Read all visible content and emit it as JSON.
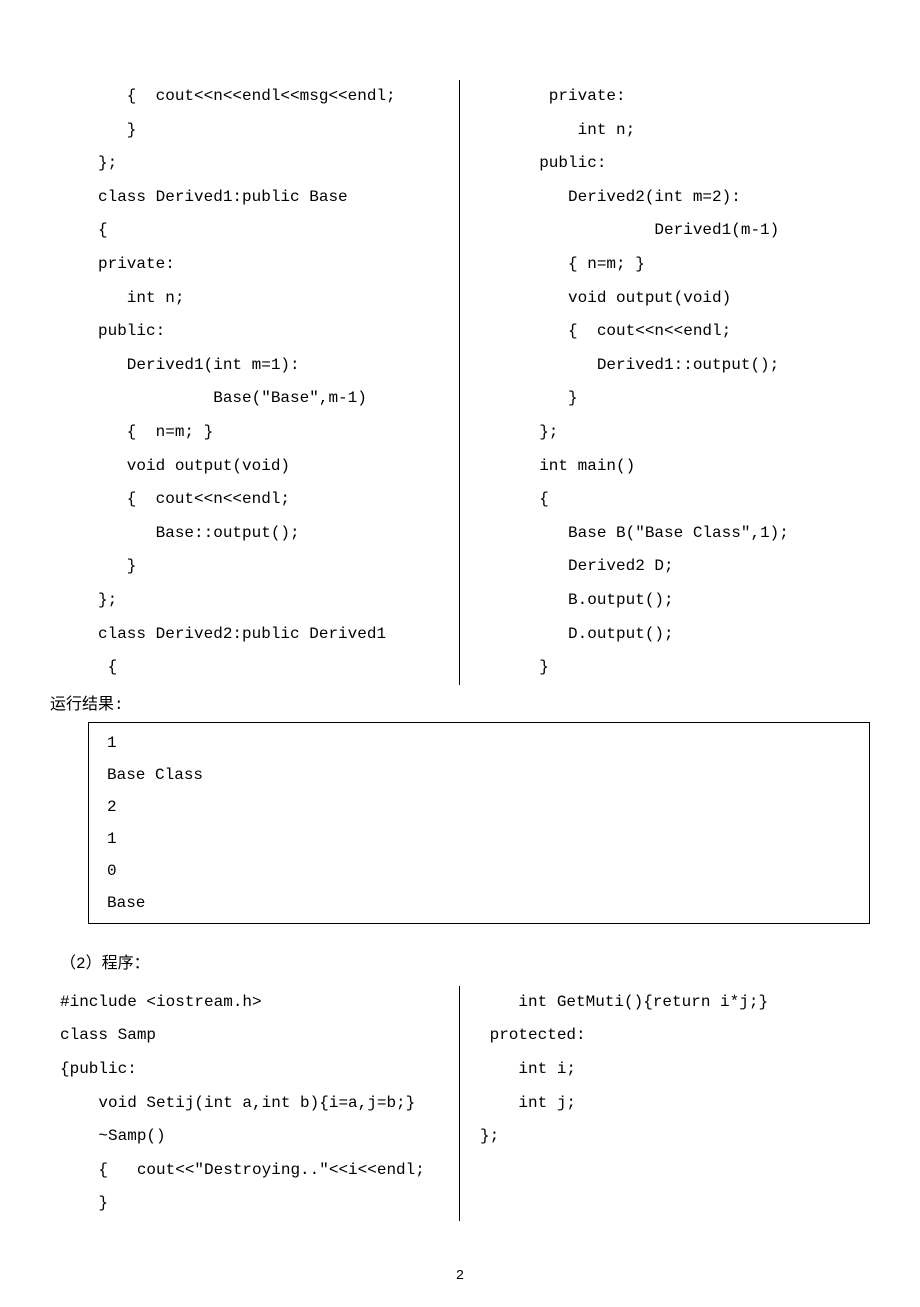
{
  "code_block_1": {
    "left": "   {  cout<<n<<endl<<msg<<endl;\n   }\n};\nclass Derived1:public Base\n{\nprivate:\n   int n;\npublic:\n   Derived1(int m=1):\n            Base(\"Base\",m-1)\n   {  n=m; }\n   void output(void)\n   {  cout<<n<<endl;\n      Base::output();\n   }\n};\nclass Derived2:public Derived1\n {",
    "right": "   private:\n      int n;\n  public:\n     Derived2(int m=2):\n              Derived1(m-1)\n     { n=m; }\n     void output(void)\n     {  cout<<n<<endl;\n        Derived1::output();\n     }\n  };\n  int main()\n  {\n     Base B(\"Base Class\",1);\n     Derived2 D;\n     B.output();\n     D.output();\n  }"
  },
  "result_heading": "运行结果:",
  "result_output": "1\nBase Class\n2\n1\n0\nBase",
  "program2_heading": "（2）程序：",
  "code_block_2": {
    "left": "#include <iostream.h>\nclass Samp\n{public:\n    void Setij(int a,int b){i=a,j=b;}\n    ~Samp()\n    {   cout<<\"Destroying..\"<<i<<endl;\n    }",
    "right": "    int GetMuti(){return i*j;}\n protected:\n    int i;\n    int j;\n};"
  },
  "page_number": "2"
}
